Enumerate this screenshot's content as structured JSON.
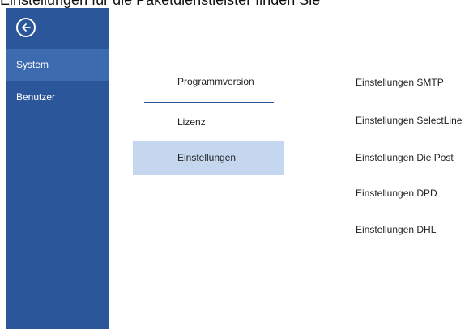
{
  "top_caption": "Einstellungen für die Paketdienstleister finden Sie",
  "sidebar": {
    "back_icon": "arrow-left-circle-icon",
    "items": [
      {
        "label": "System",
        "selected": true
      },
      {
        "label": "Benutzer",
        "selected": false
      }
    ],
    "color": "#2b579a"
  },
  "middle": {
    "items": [
      {
        "label": "Programmversion"
      },
      {
        "label": "Lizenz"
      },
      {
        "label": "Einstellungen",
        "active": true
      }
    ]
  },
  "right": {
    "items": [
      {
        "label": "Einstellungen SMTP"
      },
      {
        "label": "Einstellungen SelectLine"
      },
      {
        "label": "Einstellungen Die Post"
      },
      {
        "label": "Einstellungen DPD"
      },
      {
        "label": "Einstellungen DHL"
      }
    ]
  }
}
